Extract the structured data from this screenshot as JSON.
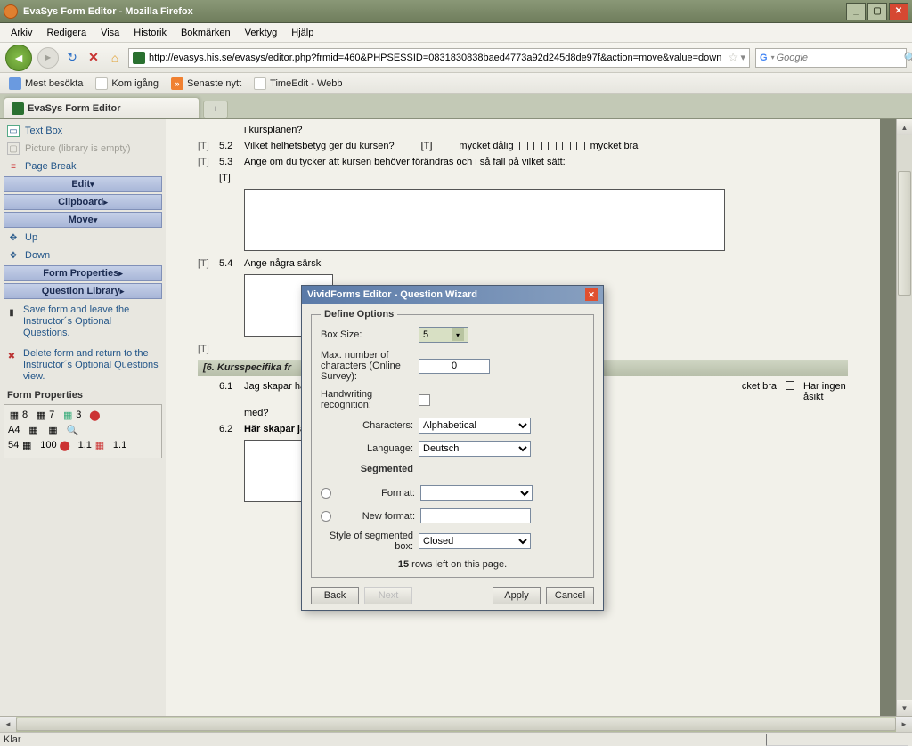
{
  "window": {
    "title": "EvaSys Form Editor - Mozilla Firefox"
  },
  "menu": [
    "Arkiv",
    "Redigera",
    "Visa",
    "Historik",
    "Bokmärken",
    "Verktyg",
    "Hjälp"
  ],
  "url": "http://evasys.his.se/evasys/editor.php?frmid=460&PHPSESSID=0831830838baed4773a92d245d8de97f&action=move&value=down",
  "search_placeholder": "Google",
  "bookmarks": [
    "Mest besökta",
    "Kom igång",
    "Senaste nytt",
    "TimeEdit - Webb"
  ],
  "tab": {
    "label": "EvaSys Form Editor",
    "newtab": "+"
  },
  "sidebar": {
    "items": [
      "Text Box",
      "Picture (library is empty)",
      "Page Break"
    ],
    "heads": [
      "Edit",
      "Clipboard",
      "Move",
      "Form Properties",
      "Question Library"
    ],
    "move_items": [
      "Up",
      "Down"
    ],
    "links": [
      "Save form and leave the Instructor´s Optional Questions.",
      "Delete form and return to the Instructor´s Optional Questions view."
    ],
    "props_title": "Form Properties",
    "props": {
      "r1": [
        "8",
        "7",
        "3"
      ],
      "r2": [
        "A4",
        "",
        ""
      ],
      "r3": [
        "54",
        "100",
        "1.1",
        "1.1"
      ]
    }
  },
  "canvas": {
    "q51_tail": "i kursplanen?",
    "q52": {
      "num": "5.2",
      "text": "Vilket helhetsbetyg ger du kursen?",
      "left": "mycket dålig",
      "right": "mycket bra"
    },
    "q53": {
      "num": "5.3",
      "text": "Ange om du tycker att kursen behöver förändras och i så fall på vilket sätt:"
    },
    "q54": {
      "num": "5.4",
      "text": "Ange några särski"
    },
    "sec6": "[6. Kursspecifika fr",
    "q61": {
      "num": "6.1",
      "text": "Jag skapar här en",
      "text2": "med?",
      "right1": "cket bra",
      "right2": "Har ingen åsikt"
    },
    "q62": {
      "num": "6.2",
      "text": "Här skapar jag n"
    }
  },
  "dialog": {
    "title": "VividForms Editor - Question Wizard",
    "legend": "Define Options",
    "labels": {
      "box_size": "Box Size:",
      "max_chars": "Max. number of characters (Online Survey):",
      "handwriting": "Handwriting recognition:",
      "characters": "Characters:",
      "language": "Language:",
      "segmented": "Segmented",
      "format": "Format:",
      "new_format": "New format:",
      "style": "Style of segmented box:"
    },
    "values": {
      "box_size": "5",
      "max_chars": "0",
      "characters": "Alphabetical",
      "language": "Deutsch",
      "style": "Closed"
    },
    "rows_left_n": "15",
    "rows_left_text": " rows left on this page.",
    "buttons": {
      "back": "Back",
      "next": "Next",
      "apply": "Apply",
      "cancel": "Cancel"
    }
  },
  "status": "Klar"
}
